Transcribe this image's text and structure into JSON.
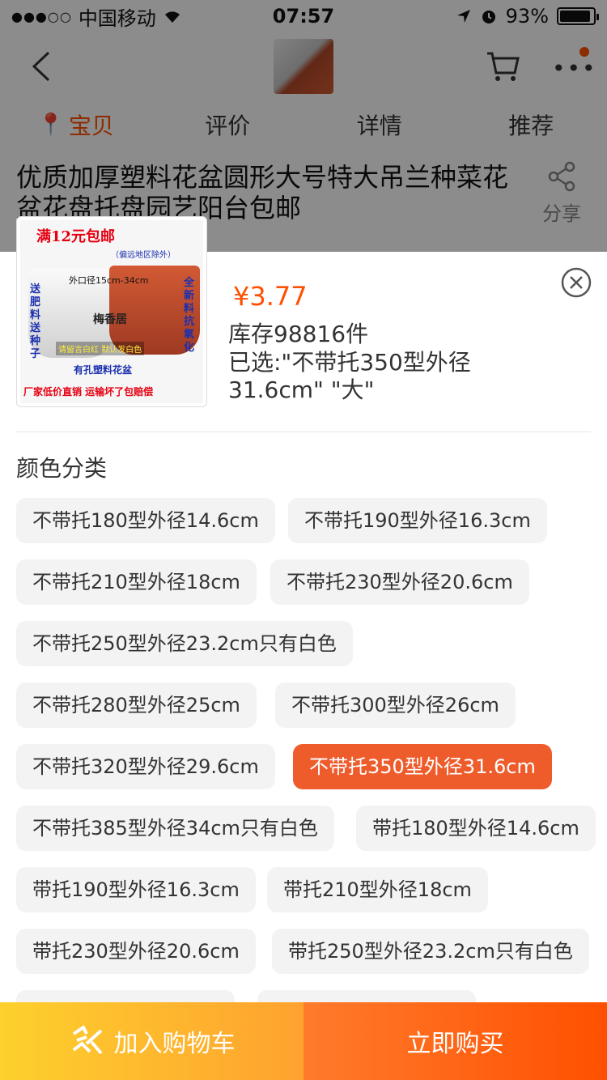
{
  "status_bar": {
    "signal": "●●●○○",
    "carrier": "中国移动",
    "time": "07:57",
    "battery": "93%"
  },
  "nav": {
    "tabs": [
      {
        "label": "宝贝",
        "active": true
      },
      {
        "label": "评价",
        "active": false
      },
      {
        "label": "详情",
        "active": false
      },
      {
        "label": "推荐",
        "active": false
      }
    ]
  },
  "product": {
    "title": "优质加厚塑料花盆圆形大号特大吊兰种菜花盆花盘托盘园艺阳台包邮",
    "share_label": "分享"
  },
  "sku_panel": {
    "image_text": {
      "promo": "满12元包邮",
      "promo_note": "（偏远地区除外）",
      "size": "外口径15cm-34cm",
      "brand": "梅香居",
      "left_side": "送肥料送种子",
      "right_side": "全新料抗氧化",
      "note": "请留言白红 默认发白色",
      "note2": "有孔塑料花盆",
      "footer": "厂家低价直销 运输坏了包赔偿"
    },
    "price": "¥3.77",
    "stock": "库存98816件",
    "selected": "已选:\"不带托350型外径31.6cm\" \"大\"",
    "section_title": "颜色分类",
    "options": [
      {
        "label": "不带托180型外径14.6cm",
        "selected": false
      },
      {
        "label": "不带托190型外径16.3cm",
        "selected": false
      },
      {
        "label": "不带托210型外径18cm",
        "selected": false
      },
      {
        "label": "不带托230型外径20.6cm",
        "selected": false
      },
      {
        "label": "不带托250型外径23.2cm只有白色",
        "selected": false
      },
      {
        "label": "不带托280型外径25cm",
        "selected": false
      },
      {
        "label": "不带托300型外径26cm",
        "selected": false
      },
      {
        "label": "不带托320型外径29.6cm",
        "selected": false
      },
      {
        "label": "不带托350型外径31.6cm",
        "selected": true
      },
      {
        "label": "不带托385型外径34cm只有白色",
        "selected": false
      },
      {
        "label": "带托180型外径14.6cm",
        "selected": false
      },
      {
        "label": "带托190型外径16.3cm",
        "selected": false
      },
      {
        "label": "带托210型外径18cm",
        "selected": false
      },
      {
        "label": "带托230型外径20.6cm",
        "selected": false
      },
      {
        "label": "带托250型外径23.2cm只有白色",
        "selected": false
      }
    ]
  },
  "bottom": {
    "add_cart": "加入购物车",
    "buy_now": "立即购买"
  },
  "colors": {
    "accent": "#ff5000",
    "selected_option": "#ee5c2c",
    "cart_gradient_start": "#fdd02d",
    "buy_gradient_end": "#ff5000"
  }
}
